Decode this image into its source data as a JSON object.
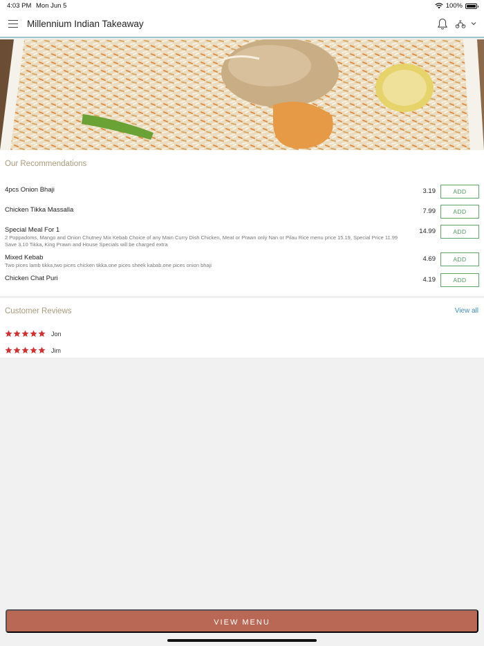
{
  "status_bar": {
    "time": "4:03 PM",
    "date": "Mon Jun 5",
    "battery": "100%",
    "icons": [
      "wifi-icon",
      "battery-icon"
    ]
  },
  "navbar": {
    "title": "Millennium Indian Takeaway",
    "icons": [
      "menu-icon",
      "bell-icon",
      "delivery-icon",
      "chevron-down-icon"
    ]
  },
  "hero": {
    "image": "biryani-dish-photo"
  },
  "recommendations": {
    "title": "Our Recommendations",
    "add_label": "ADD",
    "items": [
      {
        "name": "4pcs Onion Bhaji",
        "description": "",
        "price": "3.19"
      },
      {
        "name": "Chicken Tikka Massalla",
        "description": "",
        "price": "7.99"
      },
      {
        "name": "Special Meal For 1",
        "description": "2 Poppadoms, Mango and Onion Chutney Mix Kebab Choice of any Main Curry Dish Chicken, Meat or Prawn only Nan or Pilau Rice menu price 15.19, Special Price 11.99 Save 3.10 Tikka, King Prawn and House Specials will be charged extra",
        "price": "14.99"
      },
      {
        "name": "Mixed Kebab",
        "description": "Two pices lamb tikka,two pices chicken tikka.one pices sheek kabab.one pices onion bhaji",
        "price": "4.69"
      },
      {
        "name": "Chicken Chat Puri",
        "description": "",
        "price": "4.19"
      }
    ]
  },
  "reviews": {
    "title": "Customer Reviews",
    "view_all": "View all",
    "items": [
      {
        "name": "Jon",
        "rating": 5
      },
      {
        "name": "Jim",
        "rating": 5
      }
    ]
  },
  "footer": {
    "view_menu_label": "VIEW MENU"
  },
  "colors": {
    "accent_button": "#b86855",
    "add_button_green": "#4f9b5f",
    "star_red": "#d32f2f",
    "section_title": "#a89a7c",
    "link_blue": "#3a8fba"
  }
}
